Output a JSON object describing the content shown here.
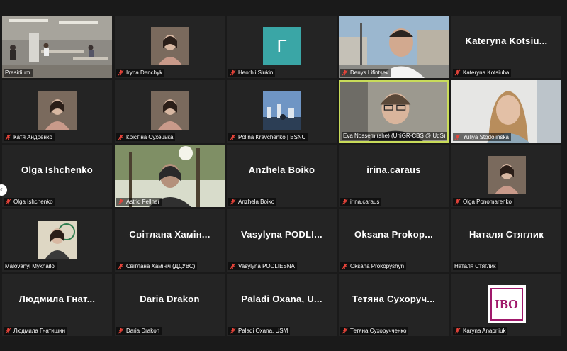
{
  "participants": [
    {
      "name": "Presidium",
      "muted": false,
      "video": "room"
    },
    {
      "name": "Iryna Denchyk",
      "muted": true,
      "video": "photo"
    },
    {
      "name": "Heorhii Slukin",
      "muted": true,
      "video": "initial",
      "initial": "Г",
      "initial_color": "#3aa6a6"
    },
    {
      "name": "Denys Lifintsev",
      "muted": true,
      "video": "street"
    },
    {
      "name": "Kateryna Kotsiuba",
      "muted": true,
      "video": "none",
      "center_text": "Kateryna Kotsiu..."
    },
    {
      "name": "Катя Андренко",
      "muted": true,
      "video": "photo"
    },
    {
      "name": "Крістіна Сухецька",
      "muted": true,
      "video": "photo"
    },
    {
      "name": "Polina Kravchenko | BSNU",
      "muted": true,
      "video": "city-photo"
    },
    {
      "name": "Eva Nossem (she) (UniGR-CBS @ UdS)",
      "muted": false,
      "video": "person",
      "active": true
    },
    {
      "name": "Yuliya Stodolinska",
      "muted": true,
      "video": "person-light"
    },
    {
      "name": "Olga Ishchenko",
      "muted": true,
      "video": "none",
      "center_text": "Olga Ishchenko"
    },
    {
      "name": "Astrid Fellner",
      "muted": true,
      "video": "park"
    },
    {
      "name": "Anzhela Boiko",
      "muted": true,
      "video": "none",
      "center_text": "Anzhela Boiko"
    },
    {
      "name": "irina.caraus",
      "muted": true,
      "video": "none",
      "center_text": "irina.caraus"
    },
    {
      "name": "Olga Ponomarenko",
      "muted": true,
      "video": "photo"
    },
    {
      "name": "Malovanyi Mykhailo",
      "muted": false,
      "video": "photo-seal"
    },
    {
      "name": "Світлана Хамініч (ДДУВС)",
      "muted": true,
      "video": "none",
      "center_text": "Світлана Хамін..."
    },
    {
      "name": "Vasylyna PODLIESNA",
      "muted": true,
      "video": "none",
      "center_text": "Vasylyna PODLI..."
    },
    {
      "name": "Oksana Prokopyshyn",
      "muted": true,
      "video": "none",
      "center_text": "Oksana Prokop..."
    },
    {
      "name": "Наталя Стяглик",
      "muted": false,
      "video": "none",
      "center_text": "Наталя Стяглик"
    },
    {
      "name": "Людмила Гнатишин",
      "muted": true,
      "video": "none",
      "center_text": "Людмила Гнат..."
    },
    {
      "name": "Daria Drakon",
      "muted": true,
      "video": "none",
      "center_text": "Daria Drakon"
    },
    {
      "name": "Paladi Oxana, USM",
      "muted": true,
      "video": "none",
      "center_text": "Paladi Oxana, U..."
    },
    {
      "name": "Тетяна Сухоручченко",
      "muted": true,
      "video": "none",
      "center_text": "Тетяна Сухоруч..."
    },
    {
      "name": "Karyna Anapriiuk",
      "muted": true,
      "video": "logo",
      "logo_text": "IBO",
      "logo_color": "#a0196b"
    }
  ]
}
